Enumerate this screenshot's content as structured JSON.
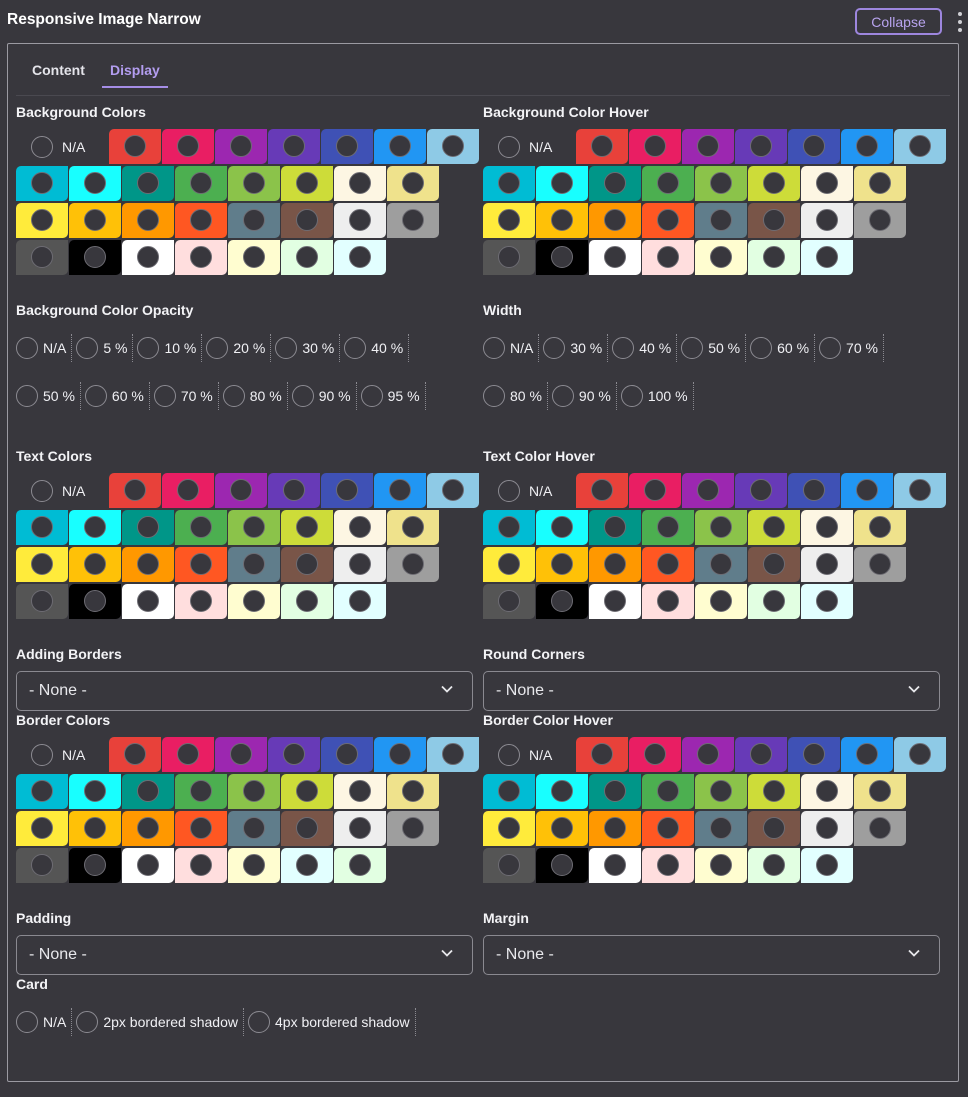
{
  "header": {
    "title": "Responsive Image Narrow",
    "collapse_label": "Collapse"
  },
  "tabs": [
    {
      "label": "Content"
    },
    {
      "label": "Display"
    }
  ],
  "na_label": "N/A",
  "palette": {
    "row0": [
      "#e8413a",
      "#e91e63",
      "#9c27b0",
      "#673ab7",
      "#3f51b5",
      "#2196f3",
      "#8ecae6"
    ],
    "row1": [
      "#00bcd4",
      "#18ffff",
      "#009688",
      "#4caf50",
      "#8bc34a",
      "#cddc39",
      "#fdf6e3",
      "#efe28c"
    ],
    "row2": [
      "#ffeb3b",
      "#ffc107",
      "#ff9800",
      "#ff5722",
      "#607d8b",
      "#795548",
      "#eeeeee",
      "#9e9e9e"
    ],
    "row3": [
      "#555555",
      "#000000",
      "#ffffff",
      "#ffdede",
      "#fffdd0",
      "#e2ffe2",
      "#e2ffff"
    ]
  },
  "palette_alt_row3": [
    "#555555",
    "#000000",
    "#ffffff",
    "#ffdede",
    "#fffdd0",
    "#e2ffff",
    "#e2ffe2"
  ],
  "sections": {
    "bg_colors": "Background Colors",
    "bg_color_hover": "Background Color Hover",
    "bg_opacity": "Background Color Opacity",
    "width": "Width",
    "text_colors": "Text Colors",
    "text_color_hover": "Text Color Hover",
    "adding_borders": "Adding Borders",
    "round_corners": "Round Corners",
    "border_colors": "Border Colors",
    "border_color_hover": "Border Color Hover",
    "padding": "Padding",
    "margin": "Margin",
    "card": "Card"
  },
  "opacity_options_row1": [
    "N/A",
    "5 %",
    "10 %",
    "20 %",
    "30 %",
    "40 %"
  ],
  "opacity_options_row2": [
    "50 %",
    "60 %",
    "70 %",
    "80 %",
    "90 %",
    "95 %"
  ],
  "width_options_row1": [
    "N/A",
    "30 %",
    "40 %",
    "50 %",
    "60 %",
    "70 %"
  ],
  "width_options_row2": [
    "80 %",
    "90 %",
    "100 %"
  ],
  "card_options": [
    "N/A",
    "2px bordered shadow",
    "4px bordered shadow"
  ],
  "selects": {
    "adding_borders": "- None -",
    "round_corners": "- None -",
    "padding": "- None -",
    "margin": "- None -"
  },
  "icons": {
    "collapse": "kebab-menu-icon",
    "select": "chevron-down-icon"
  }
}
